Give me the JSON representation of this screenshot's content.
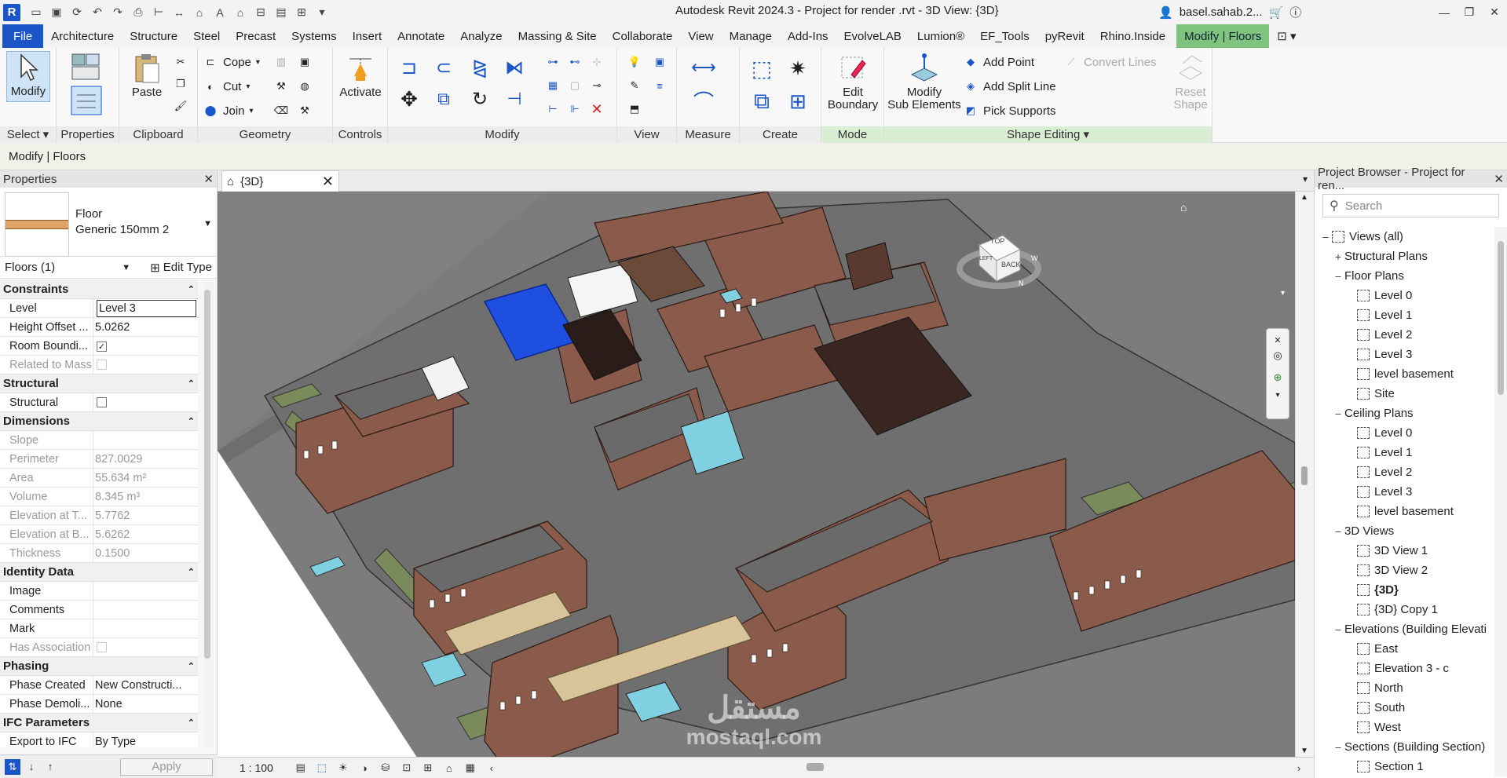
{
  "app": {
    "logo": "R",
    "title": "Autodesk Revit 2024.3 - Project for render .rvt - 3D View: {3D}",
    "user": "basel.sahab.2..."
  },
  "menu": {
    "file": "File",
    "tabs": [
      "Architecture",
      "Structure",
      "Steel",
      "Precast",
      "Systems",
      "Insert",
      "Annotate",
      "Analyze",
      "Massing & Site",
      "Collaborate",
      "View",
      "Manage",
      "Add-Ins",
      "EvolveLAB",
      "Lumion®",
      "EF_Tools",
      "pyRevit",
      "Rhino.Inside"
    ],
    "context_tab": "Modify | Floors"
  },
  "ribbon": {
    "select": {
      "modify": "Modify",
      "label": "Select ▾"
    },
    "properties": {
      "label": "Properties"
    },
    "clipboard": {
      "paste": "Paste",
      "label": "Clipboard"
    },
    "geometry": {
      "cope": "Cope",
      "cut": "Cut",
      "join": "Join",
      "label": "Geometry"
    },
    "controls": {
      "activate": "Activate",
      "label": "Controls"
    },
    "modify": {
      "label": "Modify"
    },
    "view": {
      "label": "View"
    },
    "measure": {
      "label": "Measure"
    },
    "create": {
      "label": "Create"
    },
    "mode": {
      "edit_boundary_1": "Edit",
      "edit_boundary_2": "Boundary",
      "label": "Mode"
    },
    "shape": {
      "modify_sub_1": "Modify",
      "modify_sub_2": "Sub Elements",
      "add_point": "Add Point",
      "add_split_line": "Add Split Line",
      "pick_supports": "Pick Supports",
      "convert_lines": "Convert Lines",
      "reset_shape_1": "Reset",
      "reset_shape_2": "Shape",
      "label": "Shape Editing ▾"
    }
  },
  "options_bar": {
    "text": "Modify | Floors"
  },
  "properties": {
    "header": "Properties",
    "type_line1": "Floor",
    "type_line2": "Generic 150mm 2",
    "filter": "Floors (1)",
    "edit_type": "Edit Type",
    "apply": "Apply",
    "sections": [
      {
        "title": "Constraints",
        "rows": [
          {
            "k": "Level",
            "v": "Level 3",
            "kind": "input"
          },
          {
            "k": "Height Offset ...",
            "v": "5.0262"
          },
          {
            "k": "Room Boundi...",
            "v": "✓",
            "kind": "check"
          },
          {
            "k": "Related to Mass",
            "v": "",
            "kind": "check",
            "grey": true
          }
        ]
      },
      {
        "title": "Structural",
        "rows": [
          {
            "k": "Structural",
            "v": "",
            "kind": "check"
          }
        ]
      },
      {
        "title": "Dimensions",
        "rows": [
          {
            "k": "Slope",
            "v": "",
            "grey": true
          },
          {
            "k": "Perimeter",
            "v": "827.0029",
            "grey": true
          },
          {
            "k": "Area",
            "v": "55.634 m²",
            "grey": true
          },
          {
            "k": "Volume",
            "v": "8.345 m³",
            "grey": true
          },
          {
            "k": "Elevation at T...",
            "v": "5.7762",
            "grey": true
          },
          {
            "k": "Elevation at B...",
            "v": "5.6262",
            "grey": true
          },
          {
            "k": "Thickness",
            "v": "0.1500",
            "grey": true
          }
        ]
      },
      {
        "title": "Identity Data",
        "rows": [
          {
            "k": "Image",
            "v": ""
          },
          {
            "k": "Comments",
            "v": ""
          },
          {
            "k": "Mark",
            "v": ""
          },
          {
            "k": "Has Association",
            "v": "",
            "kind": "check",
            "grey": true
          }
        ]
      },
      {
        "title": "Phasing",
        "rows": [
          {
            "k": "Phase Created",
            "v": "New Constructi..."
          },
          {
            "k": "Phase Demoli...",
            "v": "None"
          }
        ]
      },
      {
        "title": "IFC Parameters",
        "rows": [
          {
            "k": "Export to IFC",
            "v": "By Type"
          }
        ]
      }
    ]
  },
  "view": {
    "tab": "{3D}",
    "scale": "1 : 100",
    "cube_top": "TOP",
    "cube_back": "BACK",
    "cube_left": "LEFT",
    "compass_w": "W",
    "compass_n": "N"
  },
  "watermark": {
    "arabic": "مستقل",
    "latin": "mostaql.com"
  },
  "browser": {
    "title": "Project Browser - Project for ren...",
    "search": "Search",
    "tree": [
      {
        "t": "Views (all)",
        "lvl": 0,
        "tg": "−",
        "icon": true
      },
      {
        "t": "Structural Plans",
        "lvl": 1,
        "tg": "+"
      },
      {
        "t": "Floor Plans",
        "lvl": 1,
        "tg": "−"
      },
      {
        "t": "Level 0",
        "lvl": 2,
        "icon": true
      },
      {
        "t": "Level 1",
        "lvl": 2,
        "icon": true
      },
      {
        "t": "Level 2",
        "lvl": 2,
        "icon": true
      },
      {
        "t": "Level 3",
        "lvl": 2,
        "icon": true
      },
      {
        "t": "level basement",
        "lvl": 2,
        "icon": true
      },
      {
        "t": "Site",
        "lvl": 2,
        "icon": true
      },
      {
        "t": "Ceiling Plans",
        "lvl": 1,
        "tg": "−"
      },
      {
        "t": "Level 0",
        "lvl": 2,
        "icon": true
      },
      {
        "t": "Level 1",
        "lvl": 2,
        "icon": true
      },
      {
        "t": "Level 2",
        "lvl": 2,
        "icon": true
      },
      {
        "t": "Level 3",
        "lvl": 2,
        "icon": true
      },
      {
        "t": "level basement",
        "lvl": 2,
        "icon": true
      },
      {
        "t": "3D Views",
        "lvl": 1,
        "tg": "−"
      },
      {
        "t": "3D View 1",
        "lvl": 2,
        "icon": true
      },
      {
        "t": "3D View 2",
        "lvl": 2,
        "icon": true
      },
      {
        "t": "{3D}",
        "lvl": 2,
        "icon": true,
        "bold": true
      },
      {
        "t": "{3D} Copy 1",
        "lvl": 2,
        "icon": true
      },
      {
        "t": "Elevations (Building Elevati",
        "lvl": 1,
        "tg": "−"
      },
      {
        "t": "East",
        "lvl": 2,
        "icon": true
      },
      {
        "t": "Elevation 3 - c",
        "lvl": 2,
        "icon": true
      },
      {
        "t": "North",
        "lvl": 2,
        "icon": true
      },
      {
        "t": "South",
        "lvl": 2,
        "icon": true
      },
      {
        "t": "West",
        "lvl": 2,
        "icon": true
      },
      {
        "t": "Sections (Building Section)",
        "lvl": 1,
        "tg": "−"
      },
      {
        "t": "Section 1",
        "lvl": 2,
        "icon": true
      }
    ]
  },
  "colors": {
    "file_tab": "#1a56c8",
    "context_tab": "#7ec47e",
    "selected_floor": "#1f4fe0",
    "brick": "#8a5a4a",
    "ground": "#808080",
    "pool": "#7fd0e0"
  }
}
